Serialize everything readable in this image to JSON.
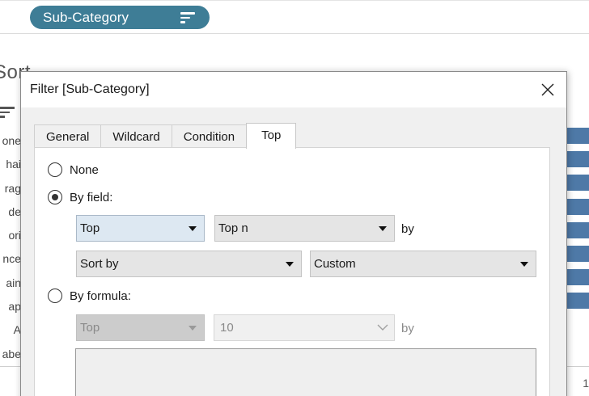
{
  "background": {
    "shelf_pill": {
      "label": "Sub-Category",
      "icon": "sort-icon",
      "color": "#3e7d96"
    },
    "sheet_title": "Sort",
    "row_labels": [
      "one",
      "hai",
      "rag",
      "de",
      "ori",
      "nce",
      "ain",
      "ap",
      "A",
      "abe"
    ],
    "bar_color": "#4e79a7",
    "axis_tick": "1"
  },
  "dialog": {
    "title": "Filter [Sub-Category]",
    "close_icon": "close-icon",
    "tabs": [
      {
        "label": "General",
        "active": false
      },
      {
        "label": "Wildcard",
        "active": false
      },
      {
        "label": "Condition",
        "active": false
      },
      {
        "label": "Top",
        "active": true
      }
    ],
    "options": {
      "none": {
        "label": "None",
        "selected": false
      },
      "by_field": {
        "label": "By field:",
        "selected": true,
        "direction": "Top",
        "count": "Top n",
        "by": "by",
        "sort": "Sort by",
        "aggregation": "Custom"
      },
      "by_formula": {
        "label": "By formula:",
        "selected": false,
        "direction": "Top",
        "count": "10",
        "by": "by"
      }
    }
  }
}
